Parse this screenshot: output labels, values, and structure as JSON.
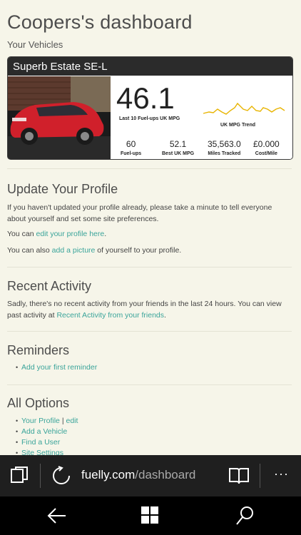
{
  "page": {
    "title": "Coopers's dashboard",
    "vehicles_heading": "Your Vehicles"
  },
  "vehicle": {
    "name": "Superb Estate SE-L",
    "mpg_value": "46.1",
    "mpg_label": "Last 10 Fuel-ups UK MPG",
    "trend_label": "UK MPG Trend",
    "trend_color": "#e8b400",
    "stats": [
      {
        "value": "60",
        "label": "Fuel-ups"
      },
      {
        "value": "52.1",
        "label": "Best UK MPG"
      },
      {
        "value": "35,563.0",
        "label": "Miles Tracked"
      },
      {
        "value": "£0.000",
        "label": "Cost/Mile"
      }
    ]
  },
  "profile": {
    "heading": "Update Your Profile",
    "intro": "If you haven't updated your profile already, please take a minute to tell everyone about yourself and set some site preferences.",
    "edit_prefix": "You can ",
    "edit_link": "edit your profile here",
    "edit_suffix": ".",
    "picture_prefix": "You can also ",
    "picture_link": "add a picture",
    "picture_suffix": " of yourself to your profile."
  },
  "activity": {
    "heading": "Recent Activity",
    "text": "Sadly, there's no recent activity from your friends in the last 24 hours. You can view past activity at ",
    "link": "Recent Activity from your friends",
    "suffix": "."
  },
  "reminders": {
    "heading": "Reminders",
    "add_link": "Add your first reminder"
  },
  "options": {
    "heading": "All Options",
    "profile_link": "Your Profile",
    "pipe": "|",
    "edit_link": "edit",
    "items": [
      "Add a Vehicle",
      "Find a User",
      "Site Settings"
    ]
  },
  "browser": {
    "url_domain": "fuelly.com",
    "url_path": "/dashboard",
    "more_label": "···"
  },
  "colors": {
    "accent_link": "#3aa49a",
    "page_bg": "#f6f5e9"
  }
}
